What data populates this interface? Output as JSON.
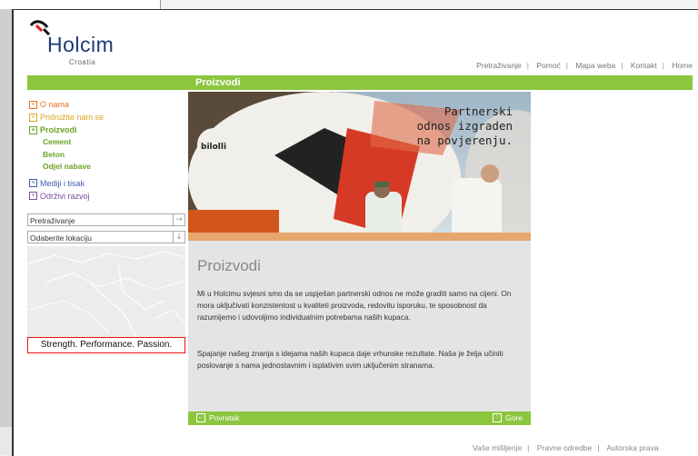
{
  "brand": {
    "name": "Holcim",
    "country": "Croatia"
  },
  "top_nav": [
    "Pretraživanje",
    "Pomoć",
    "Mapa weba",
    "Kontakt",
    "Home"
  ],
  "section_title": "Proizvodi",
  "left_nav": {
    "items": [
      {
        "label": "O nama",
        "color": "#e8741b"
      },
      {
        "label": "Pridružite nam se",
        "color": "#d9a620"
      },
      {
        "label": "Proizvodi",
        "color": "#6aa326"
      }
    ],
    "sub_items": [
      "Cement",
      "Beton",
      "Odjel nabave"
    ],
    "items_after": [
      {
        "label": "Mediji i tisak",
        "color": "#3d5fb0"
      },
      {
        "label": "Održivi razvoj",
        "color": "#7a4c9f"
      }
    ]
  },
  "search": {
    "label": "Pretraživanje",
    "location_label": "Odaberite lokaciju"
  },
  "tagline": "Strength. Performance. Passion.",
  "hero": {
    "line1": "Partnerski",
    "line2": "odnos izgraden",
    "line3": "na povjerenju.",
    "truck_brand": "bilolli"
  },
  "content": {
    "title": "Proizvodi",
    "p1": "Mi u Holcimu svjesni smo da se uspješan partnerski odnos ne može graditi samo na cijeni. On mora uključivati konzistentost u kvaliteti proizvoda, redovitu isporuku, te sposobnost da razumijemo i udovoljimo individualnim potrebama naših kupaca.",
    "p2": "Spajanje našeg znanja s idejama naših kupaca daje vrhunske rezultate. Naša je želja učiniti poslovanje s nama jednostavnim i isplativim svim uključenim stranama."
  },
  "content_footer": {
    "back": "Povratak",
    "up": "Gore"
  },
  "footer_links": [
    "Vaše mišljenje",
    "Pravne odredbe",
    "Autorska prava"
  ],
  "colors": {
    "accent_green": "#8cc63f",
    "brand_blue": "#1d3b78",
    "tagline_border": "#e11111"
  }
}
